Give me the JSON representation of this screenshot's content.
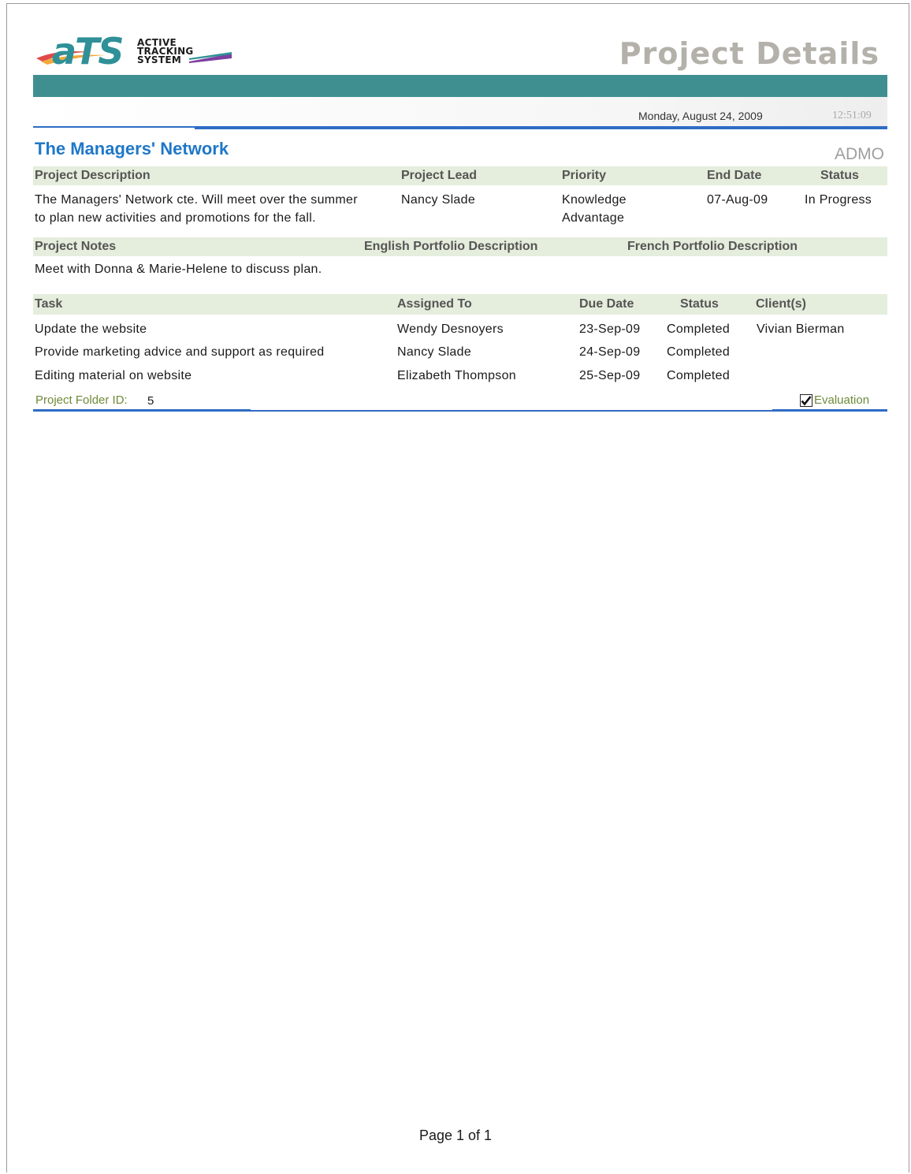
{
  "header": {
    "logo": {
      "word": "aTS",
      "line1": "ACTIVE",
      "line2": "TRACKING",
      "line3": "SYSTEM"
    },
    "title": "Project Details",
    "date": "Monday, August 24, 2009",
    "time": "12:51:09"
  },
  "project": {
    "name": "The Managers' Network",
    "code": "ADMO",
    "headers": {
      "description": "Project Description",
      "lead": "Project Lead",
      "priority": "Priority",
      "end_date": "End Date",
      "status": "Status"
    },
    "description_line1": "The Managers' Network cte. Will meet over the summer",
    "description_line2": "to plan new activities and promotions for the fall.",
    "lead": "Nancy Slade",
    "priority_line1": "Knowledge",
    "priority_line2": "Advantage",
    "end_date": "07-Aug-09",
    "status": "In Progress"
  },
  "notes": {
    "headers": {
      "notes": "Project Notes",
      "english": "English Portfolio Description",
      "french": "French Portfolio Description"
    },
    "text": "Meet with Donna & Marie-Helene to discuss plan."
  },
  "tasks": {
    "headers": {
      "task": "Task",
      "assigned": "Assigned To",
      "due": "Due Date",
      "status": "Status",
      "clients": "Client(s)"
    },
    "rows": [
      {
        "task": "Update the website",
        "assigned": "Wendy Desnoyers",
        "due": "23-Sep-09",
        "status": "Completed",
        "clients": "Vivian Bierman"
      },
      {
        "task": "Provide marketing advice and support as required",
        "assigned": "Nancy Slade",
        "due": "24-Sep-09",
        "status": "Completed",
        "clients": ""
      },
      {
        "task": "Editing material on website",
        "assigned": "Elizabeth Thompson",
        "due": "25-Sep-09",
        "status": "Completed",
        "clients": ""
      }
    ]
  },
  "folder": {
    "label": "Project Folder ID:",
    "value": "5"
  },
  "evaluation": {
    "label": "Evaluation",
    "checked": true
  },
  "footer": {
    "page": "Page 1 of 1"
  },
  "colors": {
    "teal": "#3f8f91",
    "rule_blue": "#2e6cc5",
    "title_blue": "#1f78c8",
    "band_green": "#e5eddc",
    "label_olive": "#6e8a39"
  }
}
